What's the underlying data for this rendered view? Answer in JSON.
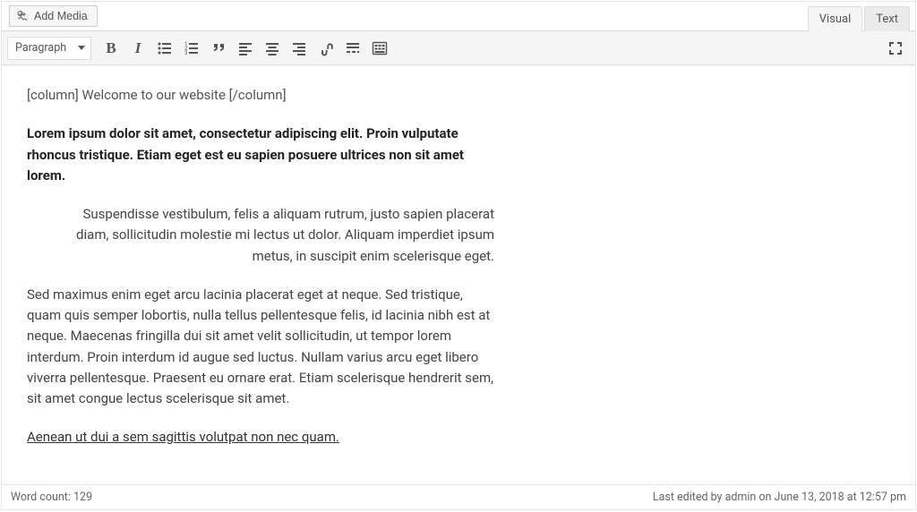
{
  "top": {
    "add_media_label": "Add Media",
    "tabs": {
      "visual": "Visual",
      "text": "Text"
    }
  },
  "toolbar": {
    "format_select": "Paragraph"
  },
  "content": {
    "shortcode": "[column] Welcome to our website [/column]",
    "bold_para": "Lorem ipsum dolor sit amet, consectetur adipiscing elit. Proin vulputate rhoncus tristique. Etiam eget est eu sapien posuere ultrices non sit amet lorem.",
    "quote": "Suspendisse vestibulum, felis a aliquam rutrum, justo sapien placerat diam, sollicitudin molestie mi lectus ut dolor. Aliquam imperdiet ipsum metus, in suscipit enim scelerisque eget.",
    "body": "Sed maximus enim eget arcu lacinia placerat eget at neque. Sed tristique, quam quis semper lobortis, nulla tellus pellentesque felis, id lacinia nibh est at neque. Maecenas fringilla dui sit amet velit sollicitudin, ut tempor lorem interdum. Proin interdum id augue sed luctus. Nullam varius arcu eget libero viverra pellentesque. Praesent eu ornare erat. Etiam scelerisque hendrerit sem, sit amet congue lectus scelerisque sit amet.",
    "underline": "Aenean ut dui a sem sagittis volutpat non nec quam."
  },
  "status": {
    "word_count_label": "Word count: 129",
    "last_edited": "Last edited by admin on June 13, 2018 at 12:57 pm"
  }
}
